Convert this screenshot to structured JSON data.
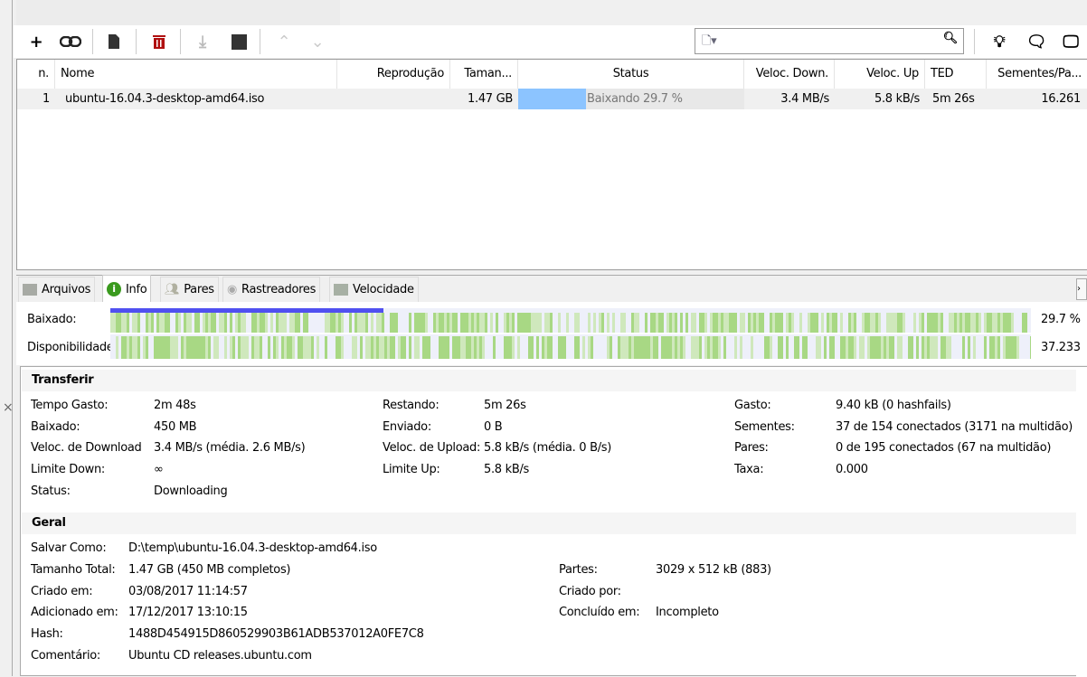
{
  "toolbar": {
    "buttons": [
      "add-icon",
      "link-icon",
      "file-icon",
      "trash-icon",
      "download-icon",
      "stop-icon",
      "up-icon",
      "down-icon"
    ],
    "search_placeholder": "",
    "right_icons": [
      "bulb-icon",
      "chat-icon",
      "monitor-icon"
    ]
  },
  "table": {
    "columns": [
      "n.",
      "Nome",
      "Reprodução",
      "Taman...",
      "Status",
      "Veloc. Down.",
      "Veloc. Up",
      "TED",
      "Sementes/Pa..."
    ],
    "rows": [
      {
        "n": "1",
        "name": "ubuntu-16.04.3-desktop-amd64.iso",
        "play": "",
        "size": "1.47 GB",
        "status": "Baixando 29.7 %",
        "progress": 29.7,
        "down": "3.4 MB/s",
        "up": "5.8 kB/s",
        "eta": "5m 26s",
        "seeds": "16.261"
      }
    ]
  },
  "tabs": [
    "Arquivos",
    "Info",
    "Pares",
    "Rastreadores",
    "Velocidade"
  ],
  "bars": {
    "downloaded_label": "Baixado:",
    "downloaded_pct": "29.7 %",
    "progress": 29.7,
    "availability_label": "Disponibilidade",
    "availability": "37.233"
  },
  "transfer": {
    "title": "Transferir",
    "col1": [
      [
        "Tempo Gasto:",
        "2m 48s"
      ],
      [
        "Baixado:",
        "450 MB"
      ],
      [
        "Veloc. de Download:",
        "3.4 MB/s (média. 2.6 MB/s)"
      ],
      [
        "Limite Down:",
        "∞"
      ],
      [
        "Status:",
        "Downloading"
      ]
    ],
    "col2": [
      [
        "Restando:",
        "5m 26s"
      ],
      [
        "Enviado:",
        "0 B"
      ],
      [
        "Veloc. de Upload:",
        "5.8 kB/s (média. 0 B/s)"
      ],
      [
        "Limite Up:",
        "5.8 kB/s"
      ]
    ],
    "col3": [
      [
        "Gasto:",
        "9.40 kB (0 hashfails)"
      ],
      [
        "Sementes:",
        "37 de 154 conectados (3171 na multidão)"
      ],
      [
        "Pares:",
        "0 de 195 conectados (67 na multidão)"
      ],
      [
        "Taxa:",
        "0.000"
      ]
    ]
  },
  "general": {
    "title": "Geral",
    "col1": [
      [
        "Salvar Como:",
        "D:\\temp\\ubuntu-16.04.3-desktop-amd64.iso"
      ],
      [
        "Tamanho Total:",
        "1.47 GB (450 MB completos)"
      ],
      [
        "Criado em:",
        "03/08/2017 11:14:57"
      ],
      [
        "Adicionado em:",
        "17/12/2017 13:10:15"
      ],
      [
        "Hash:",
        "1488D454915D860529903B61ADB537012A0FE7C8"
      ],
      [
        "Comentário:",
        "Ubuntu CD releases.ubuntu.com"
      ]
    ],
    "col2": [
      [
        "Partes:",
        "3029 x 512 kB (883)"
      ],
      [
        "Criado por:",
        ""
      ],
      [
        "Concluído em:",
        "Incompleto"
      ]
    ]
  },
  "close_label": "×"
}
